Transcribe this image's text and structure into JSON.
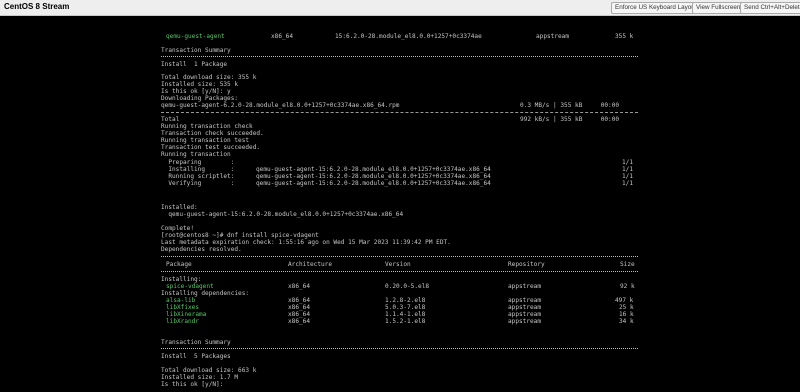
{
  "window": {
    "title": "CentOS 8 Stream",
    "buttons": [
      "Enforce US Keyboard Layout",
      "View Fullscreen",
      "Send Ctrl+Alt+Delete"
    ]
  },
  "terminal": {
    "top_row": {
      "name": "qemu-guest-agent",
      "arch": "x86_64",
      "version": "15:6.2.0-28.module_el8.0.0+1257+0c3374ae",
      "repo": "appstream",
      "size": "355 k"
    },
    "summary1": "Transaction Summary",
    "install1": "Install  1 Package",
    "dl_size1": "Total download size: 355 k",
    "inst_size1": "Installed size: 535 k",
    "prompt_ok": "Is this ok [y/N]: y",
    "downloading": "Downloading Packages:",
    "rpm_file": "qemu-guest-agent-6.2.0-28.module_el8.0.0+1257+0c3374ae.x86_64.rpm",
    "rpm_speed": "0.3 MB/s | 355 kB     00:00",
    "total_label": "Total",
    "total_speed": "992 kB/s | 355 kB     00:00",
    "tx_lines": [
      "Running transaction check",
      "Transaction check succeeded.",
      "Running transaction test",
      "Transaction test succeeded.",
      "Running transaction"
    ],
    "steps": [
      {
        "label": "  Preparing        :",
        "pkg": "",
        "count": "1/1"
      },
      {
        "label": "  Installing       :",
        "pkg": "qemu-guest-agent-15:6.2.0-28.module_el8.0.0+1257+0c3374ae.x86_64",
        "count": "1/1"
      },
      {
        "label": "  Running scriptlet:",
        "pkg": "qemu-guest-agent-15:6.2.0-28.module_el8.0.0+1257+0c3374ae.x86_64",
        "count": "1/1"
      },
      {
        "label": "  Verifying        :",
        "pkg": "qemu-guest-agent-15:6.2.0-28.module_el8.0.0+1257+0c3374ae.x86_64",
        "count": "1/1"
      }
    ],
    "installed_header": "Installed:",
    "installed_pkg": "  qemu-guest-agent-15:6.2.0-28.module_el8.0.0+1257+0c3374ae.x86_64",
    "complete": "Complete!",
    "command": "[root@centos8 ~]# dnf install spice-vdagent",
    "metadata": "Last metadata expiration check: 1:55:16 ago on Wed 15 Mar 2023 11:39:42 PM EDT.",
    "resolved": "Dependencies resolved.",
    "table_header": {
      "package": "Package",
      "arch": "Architecture",
      "version": "Version",
      "repo": "Repository",
      "size": "Size"
    },
    "installing": "Installing:",
    "main_pkg": {
      "name": "spice-vdagent",
      "arch": "x86_64",
      "version": "0.20.0-5.el8",
      "repo": "appstream",
      "size": "92 k"
    },
    "deps_header": "Installing dependencies:",
    "deps": [
      {
        "name": "alsa-lib",
        "arch": "x86_64",
        "version": "1.2.8-2.el8",
        "repo": "appstream",
        "size": "497 k"
      },
      {
        "name": "libXfixes",
        "arch": "x86_64",
        "version": "5.0.3-7.el8",
        "repo": "appstream",
        "size": "25 k"
      },
      {
        "name": "libXinerama",
        "arch": "x86_64",
        "version": "1.1.4-1.el8",
        "repo": "appstream",
        "size": "16 k"
      },
      {
        "name": "libXrandr",
        "arch": "x86_64",
        "version": "1.5.2-1.el8",
        "repo": "appstream",
        "size": "34 k"
      }
    ],
    "summary2": "Transaction Summary",
    "install2": "Install  5 Packages",
    "dl_size2": "Total download size: 663 k",
    "inst_size2": "Installed size: 1.7 M",
    "prompt2": "Is this ok [y/N]:"
  },
  "colors": {
    "terminal_bg": "#000000",
    "terminal_fg": "#c6c6c6",
    "package_green": "#55c765",
    "toolbar_bg": "#eeeeee"
  }
}
